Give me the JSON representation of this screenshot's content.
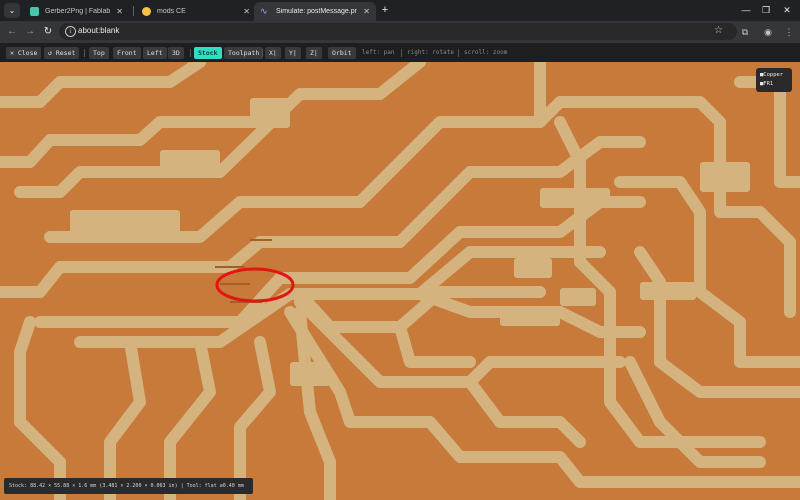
{
  "browser": {
    "tabs": [
      {
        "title": "Gerber2Png | Fablab Kerala",
        "favicon_color": "#46c7a8"
      },
      {
        "title": "mods CE",
        "favicon_color": "#f6c143"
      },
      {
        "title": "Simulate: postMessage.png",
        "favicon_color": "#8ab4f8"
      }
    ],
    "active_tab": 2,
    "address": "about:blank",
    "icons": {
      "tab_menu": "chevron-down-icon",
      "close": "close-icon",
      "new_tab": "plus-icon",
      "back": "arrow-left-icon",
      "forward": "arrow-right-icon",
      "reload": "reload-icon",
      "site_info": "info-icon",
      "bookmark": "star-icon",
      "extensions": "puzzle-icon",
      "profile": "profile-icon",
      "menu": "kebab-icon",
      "minimize": "minimize-icon",
      "maximize": "maximize-icon",
      "window_close": "close-icon"
    }
  },
  "app": {
    "buttons": {
      "close": "✕ Close",
      "reset": "↺ Reset",
      "top": "Top",
      "front": "Front",
      "left": "Left",
      "three_d": "3D",
      "stock": "Stock",
      "toolpath": "Toolpath",
      "x": "X|",
      "y": "Y|",
      "z": "Z|",
      "orbit": "Orbit"
    },
    "active_button": "Stock",
    "hints": {
      "left": "left: pan",
      "right": "right: rotate",
      "scroll": "scroll: zoom"
    },
    "layers": {
      "copper": "■Copper",
      "fr1": "■FR1"
    },
    "status": "Stock: 88.42 × 55.88 × 1.6 mm (3.481 × 2.200 × 0.063 in) | Tool: flat ⌀0.40 mm",
    "colors": {
      "accent": "#2de0c2",
      "copper": "#c77a3a",
      "trace": "#d4b37f",
      "annotation": "#e0160f"
    }
  }
}
